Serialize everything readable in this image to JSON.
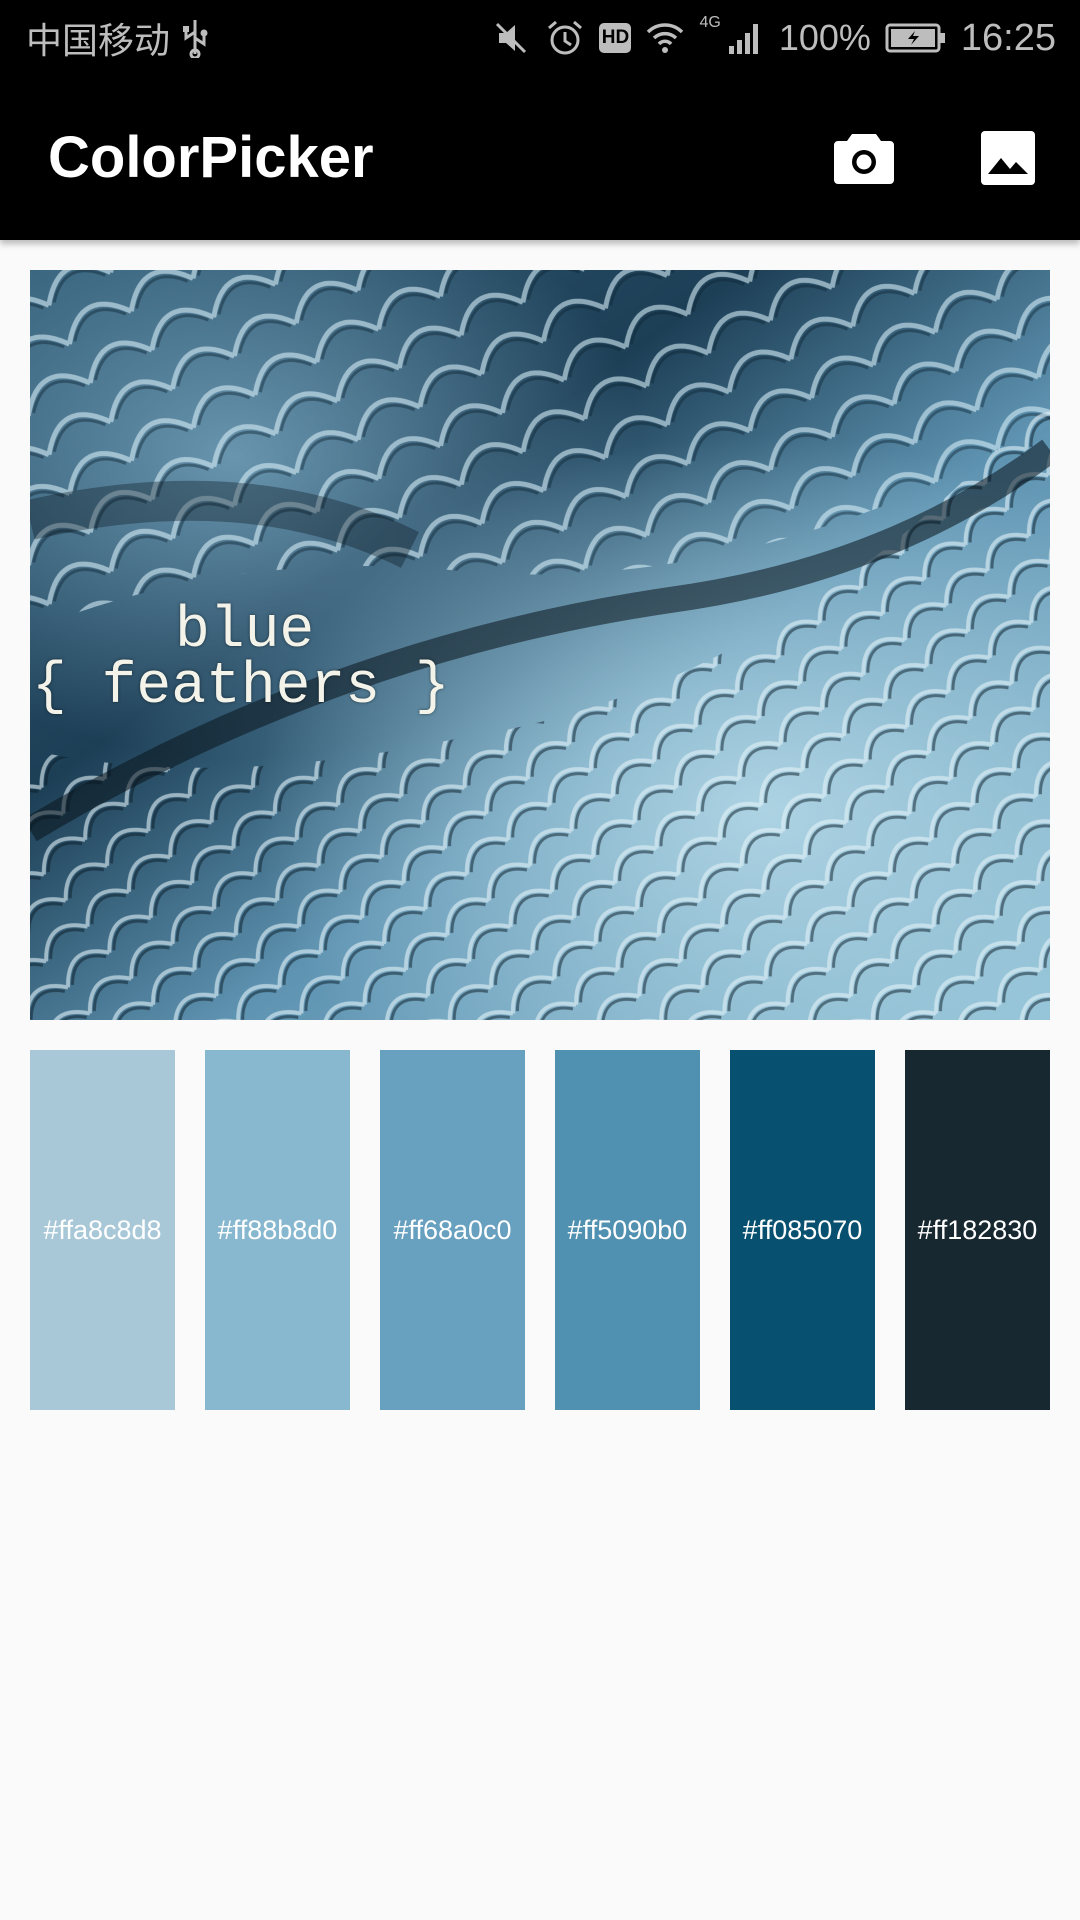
{
  "status_bar": {
    "carrier": "中国移动",
    "usb_icon": "usb-icon",
    "mute_icon": "mute-icon",
    "alarm_icon": "alarm-icon",
    "hd_label": "HD",
    "wifi_icon": "wifi-icon",
    "network_label": "4G",
    "signal_icon": "signal-icon",
    "battery_percent": "100%",
    "battery_icon": "battery-charging-icon",
    "time": "16:25"
  },
  "app_bar": {
    "title": "ColorPicker",
    "camera_icon": "camera-icon",
    "gallery_icon": "image-icon",
    "background": "#000000"
  },
  "photo": {
    "caption_line1": "blue",
    "caption_line2": "{ feathers }"
  },
  "swatches": [
    {
      "label": "#ffa8c8d8",
      "color": "#a8c8d8"
    },
    {
      "label": "#ff88b8d0",
      "color": "#88b8d0"
    },
    {
      "label": "#ff68a0c0",
      "color": "#68a0c0"
    },
    {
      "label": "#ff5090b0",
      "color": "#5090b0"
    },
    {
      "label": "#ff085070",
      "color": "#085070"
    },
    {
      "label": "#ff182830",
      "color": "#182830"
    }
  ]
}
